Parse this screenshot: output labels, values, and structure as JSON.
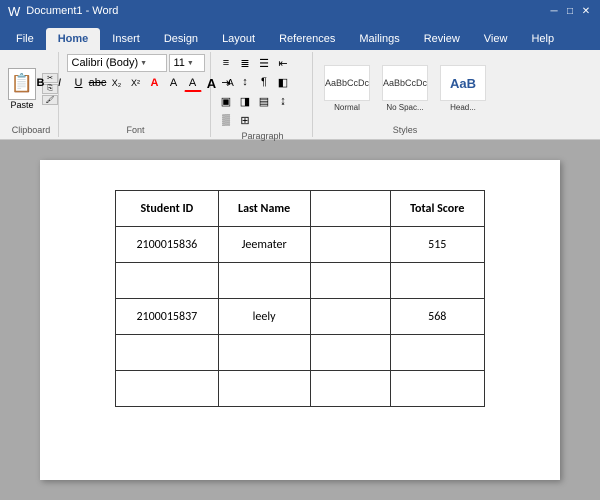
{
  "titlebar": {
    "title": "Document1 - Word",
    "window_controls": [
      "minimize",
      "maximize",
      "close"
    ]
  },
  "ribbon_tabs": [
    {
      "id": "file",
      "label": "File"
    },
    {
      "id": "home",
      "label": "Home",
      "active": true
    },
    {
      "id": "insert",
      "label": "Insert"
    },
    {
      "id": "design",
      "label": "Design"
    },
    {
      "id": "layout",
      "label": "Layout"
    },
    {
      "id": "references",
      "label": "References"
    },
    {
      "id": "mailings",
      "label": "Mailings"
    },
    {
      "id": "review",
      "label": "Review"
    },
    {
      "id": "view",
      "label": "View"
    },
    {
      "id": "help",
      "label": "Help"
    }
  ],
  "ribbon": {
    "groups": {
      "clipboard": {
        "label": "Clipboard"
      },
      "font": {
        "label": "Font",
        "name": "Calibri (Body)",
        "size": "11",
        "buttons": [
          "B",
          "I",
          "U",
          "abc",
          "X₂",
          "X²"
        ]
      },
      "paragraph": {
        "label": "Paragraph"
      },
      "styles": {
        "label": "Styles",
        "items": [
          {
            "name": "Normal",
            "preview": "AaBbCcDc"
          },
          {
            "name": "No Spac...",
            "preview": "AaBbCcDc"
          },
          {
            "name": "Head...",
            "preview": "AaB"
          }
        ]
      }
    }
  },
  "table": {
    "headers": [
      "Student ID",
      "Last Name",
      "",
      "Total Score"
    ],
    "rows": [
      {
        "student_id": "2100015836",
        "last_name": "Jeemater",
        "col3": "",
        "total_score": "515"
      },
      {
        "student_id": "",
        "last_name": "",
        "col3": "",
        "total_score": ""
      },
      {
        "student_id": "2100015837",
        "last_name": "leely",
        "col3": "",
        "total_score": "568"
      },
      {
        "student_id": "",
        "last_name": "",
        "col3": "",
        "total_score": ""
      },
      {
        "student_id": "",
        "last_name": "",
        "col3": "",
        "total_score": ""
      }
    ]
  }
}
